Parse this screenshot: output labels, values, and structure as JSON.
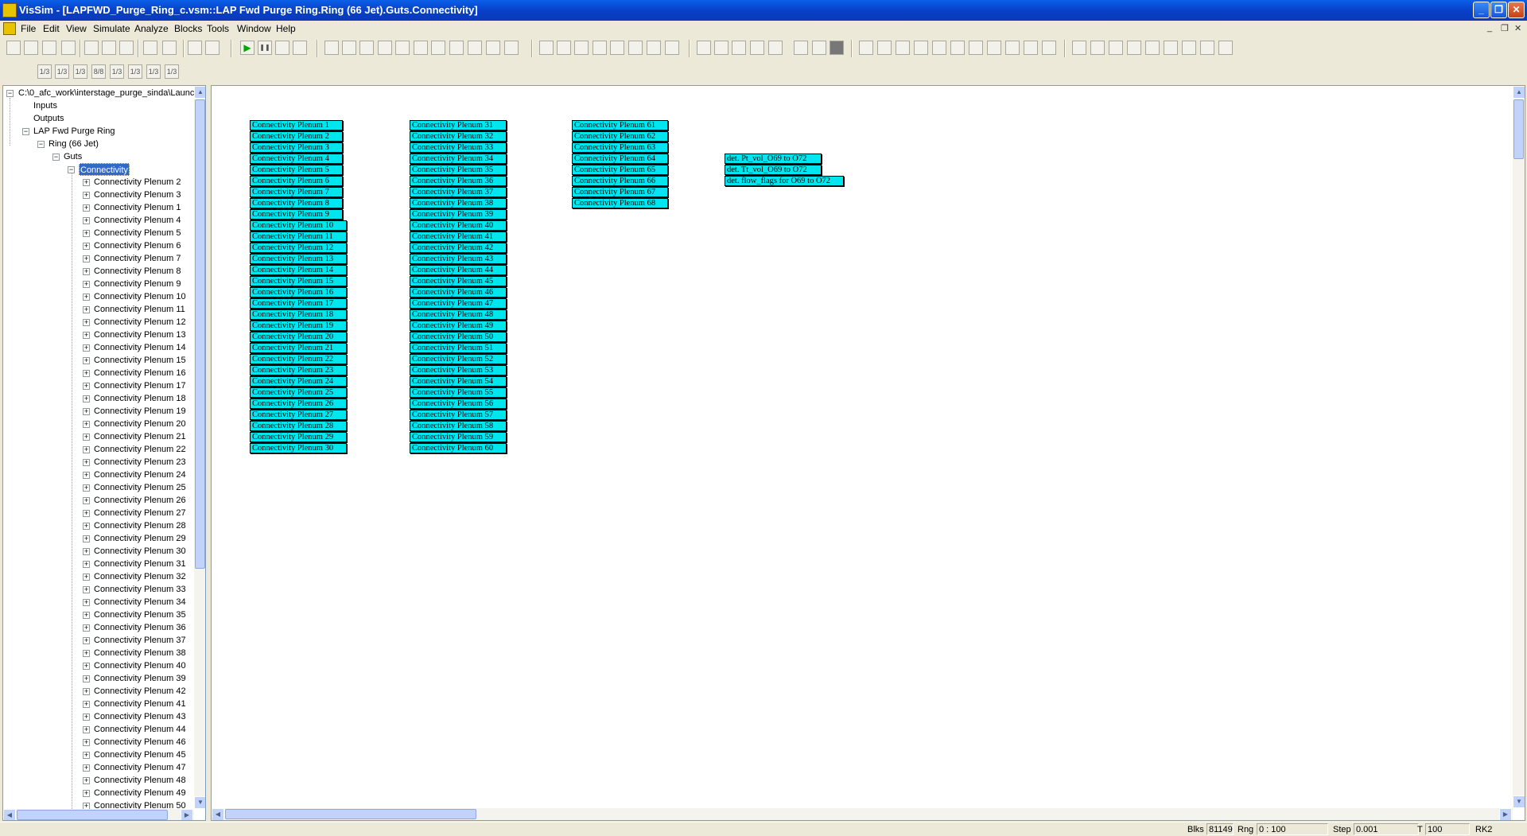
{
  "window": {
    "title": "VisSim - [LAPFWD_Purge_Ring_c.vsm::LAP Fwd Purge Ring.Ring (66 Jet).Guts.Connectivity]",
    "minimize": "_",
    "restore": "❐",
    "close": "✕"
  },
  "menu": {
    "items": [
      "File",
      "Edit",
      "View",
      "Simulate",
      "Analyze",
      "Blocks",
      "Tools",
      "Window",
      "Help"
    ],
    "mdi": [
      "_",
      "❐",
      "✕"
    ]
  },
  "toolbar": {
    "play": "▶",
    "pause": "❚❚",
    "row2": [
      "1/3",
      "1/3",
      "1/3",
      "8/8",
      "1/3",
      "1/3",
      "1/3",
      "1/3"
    ]
  },
  "tree": {
    "root": "C:\\0_afc_work\\interstage_purge_sinda\\Launc",
    "inputs": "Inputs",
    "outputs": "Outputs",
    "lap": "LAP Fwd Purge Ring",
    "ring": "Ring (66 Jet)",
    "guts": "Guts",
    "connectivity": "Connectivity",
    "children": [
      "Connectivity Plenum 2",
      "Connectivity Plenum 3",
      "Connectivity Plenum 1",
      "Connectivity Plenum 4",
      "Connectivity Plenum 5",
      "Connectivity Plenum 6",
      "Connectivity Plenum 7",
      "Connectivity Plenum 8",
      "Connectivity Plenum 9",
      "Connectivity Plenum 10",
      "Connectivity Plenum 11",
      "Connectivity Plenum 12",
      "Connectivity Plenum 13",
      "Connectivity Plenum 14",
      "Connectivity Plenum 15",
      "Connectivity Plenum 16",
      "Connectivity Plenum 17",
      "Connectivity Plenum 18",
      "Connectivity Plenum 19",
      "Connectivity Plenum 20",
      "Connectivity Plenum 21",
      "Connectivity Plenum 22",
      "Connectivity Plenum 23",
      "Connectivity Plenum 24",
      "Connectivity Plenum 25",
      "Connectivity Plenum 26",
      "Connectivity Plenum 27",
      "Connectivity Plenum 28",
      "Connectivity Plenum 29",
      "Connectivity Plenum 30",
      "Connectivity Plenum 31",
      "Connectivity Plenum 32",
      "Connectivity Plenum 33",
      "Connectivity Plenum 34",
      "Connectivity Plenum 35",
      "Connectivity Plenum 36",
      "Connectivity Plenum 37",
      "Connectivity Plenum 38",
      "Connectivity Plenum 40",
      "Connectivity Plenum 39",
      "Connectivity Plenum 42",
      "Connectivity Plenum 41",
      "Connectivity Plenum 43",
      "Connectivity Plenum 44",
      "Connectivity Plenum 46",
      "Connectivity Plenum 45",
      "Connectivity Plenum 47",
      "Connectivity Plenum 48",
      "Connectivity Plenum 49",
      "Connectivity Plenum 50"
    ]
  },
  "canvas": {
    "col1": [
      "Connectivity Plenum 1",
      "Connectivity Plenum 2",
      "Connectivity Plenum 3",
      "Connectivity Plenum 4",
      "Connectivity Plenum 5",
      "Connectivity Plenum 6",
      "Connectivity Plenum 7",
      "Connectivity Plenum 8",
      "Connectivity Plenum 9",
      "Connectivity Plenum 10",
      "Connectivity Plenum 11",
      "Connectivity Plenum 12",
      "Connectivity Plenum 13",
      "Connectivity Plenum 14",
      "Connectivity Plenum 15",
      "Connectivity Plenum 16",
      "Connectivity Plenum 17",
      "Connectivity Plenum 18",
      "Connectivity Plenum 19",
      "Connectivity Plenum 20",
      "Connectivity Plenum 21",
      "Connectivity Plenum 22",
      "Connectivity Plenum 23",
      "Connectivity Plenum 24",
      "Connectivity Plenum 25",
      "Connectivity Plenum 26",
      "Connectivity Plenum 27",
      "Connectivity Plenum 28",
      "Connectivity Plenum 29",
      "Connectivity Plenum 30"
    ],
    "col2": [
      "Connectivity Plenum 31",
      "Connectivity Plenum 32",
      "Connectivity Plenum 33",
      "Connectivity Plenum 34",
      "Connectivity Plenum 35",
      "Connectivity Plenum 36",
      "Connectivity Plenum 37",
      "Connectivity Plenum 38",
      "Connectivity Plenum 39",
      "Connectivity Plenum 40",
      "Connectivity Plenum 41",
      "Connectivity Plenum 42",
      "Connectivity Plenum 43",
      "Connectivity Plenum 44",
      "Connectivity Plenum 45",
      "Connectivity Plenum 46",
      "Connectivity Plenum 47",
      "Connectivity Plenum 48",
      "Connectivity Plenum 49",
      "Connectivity Plenum 50",
      "Connectivity Plenum 51",
      "Connectivity Plenum 52",
      "Connectivity Plenum 53",
      "Connectivity Plenum 54",
      "Connectivity Plenum 55",
      "Connectivity Plenum 56",
      "Connectivity Plenum 57",
      "Connectivity Plenum 58",
      "Connectivity Plenum 59",
      "Connectivity Plenum 60"
    ],
    "col3": [
      "Connectivity Plenum 61",
      "Connectivity Plenum 62",
      "Connectivity Plenum 63",
      "Connectivity Plenum 64",
      "Connectivity Plenum 65",
      "Connectivity Plenum 66",
      "Connectivity Plenum 67",
      "Connectivity Plenum 68"
    ],
    "col4": [
      "det. Pt_vol_O69 to O72",
      "det. Tt_vol_O69 to O72",
      "det. flow_flags for O69 to O72"
    ]
  },
  "status": {
    "blks_label": "Blks",
    "blks_value": "81149",
    "rng_label": "Rng",
    "rng_value": "0 : 100",
    "step_label": "Step",
    "step_value": "0.001",
    "t_label": "T",
    "t_value": "100",
    "method": "RK2"
  }
}
